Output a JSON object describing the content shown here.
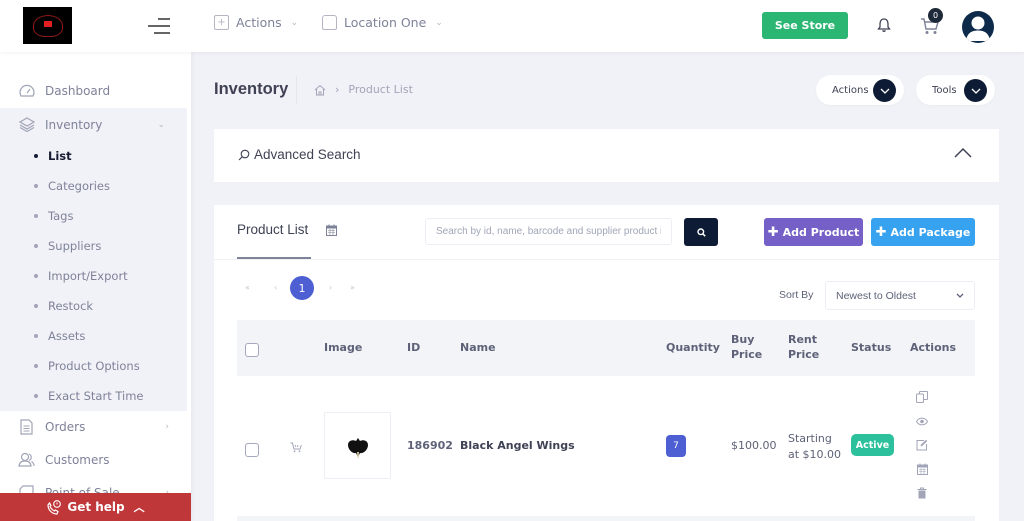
{
  "header": {
    "menus": [
      {
        "label": "Actions",
        "icon": "add-square-icon"
      },
      {
        "label": "Location One",
        "icon": "location-box-icon"
      }
    ],
    "see_store_label": "See Store",
    "cart_count": "0"
  },
  "sidebar": {
    "items": [
      {
        "label": "Dashboard",
        "icon": "dashboard-icon"
      },
      {
        "label": "Inventory",
        "icon": "layers-icon",
        "expanded": true
      },
      {
        "label": "Orders",
        "icon": "document-icon"
      },
      {
        "label": "Customers",
        "icon": "users-icon"
      },
      {
        "label": "Point of Sale",
        "icon": "pos-icon"
      }
    ],
    "inventory_sub": [
      {
        "label": "List",
        "active": true
      },
      {
        "label": "Categories"
      },
      {
        "label": "Tags"
      },
      {
        "label": "Suppliers"
      },
      {
        "label": "Import/Export"
      },
      {
        "label": "Restock"
      },
      {
        "label": "Assets"
      },
      {
        "label": "Product Options"
      },
      {
        "label": "Exact Start Time"
      }
    ],
    "get_help_label": "Get help"
  },
  "page": {
    "title": "Inventory",
    "breadcrumb": [
      "Product List"
    ],
    "actions_label": "Actions",
    "tools_label": "Tools"
  },
  "advanced_search": {
    "title": "Advanced Search"
  },
  "product_list": {
    "title": "Product List",
    "search_placeholder": "Search by id, name, barcode and supplier product id",
    "add_product_label": "Add Product",
    "add_package_label": "Add Package",
    "pagination": {
      "first": "«",
      "prev": "‹",
      "current": "1",
      "next": "›",
      "last": "»"
    },
    "sort_label": "Sort By",
    "sort_value": "Newest to Oldest",
    "columns": [
      "Image",
      "ID",
      "Name",
      "Quantity",
      "Buy Price",
      "Rent Price",
      "Status",
      "Actions"
    ],
    "columns_display": {
      "buy_price_1": "Buy",
      "buy_price_2": "Price",
      "rent_price_1": "Rent",
      "rent_price_2": "Price"
    },
    "rows": [
      {
        "id": "186902",
        "name": "Black Angel Wings",
        "quantity": "7",
        "buy_price": "$100.00",
        "rent_price_line1": "Starting",
        "rent_price_line2": "at $10.00",
        "status": "Active",
        "actions": [
          "copy-icon",
          "view-icon",
          "edit-icon",
          "calendar-icon",
          "delete-icon"
        ]
      }
    ]
  },
  "colors": {
    "see_store": "#2bb673",
    "add_product": "#7460c6",
    "add_package": "#37a2ef",
    "status_active": "#2cc09c",
    "pagination_active": "#4e5ed3",
    "get_help": "#c0373a",
    "dark_button": "#0d1b34"
  }
}
